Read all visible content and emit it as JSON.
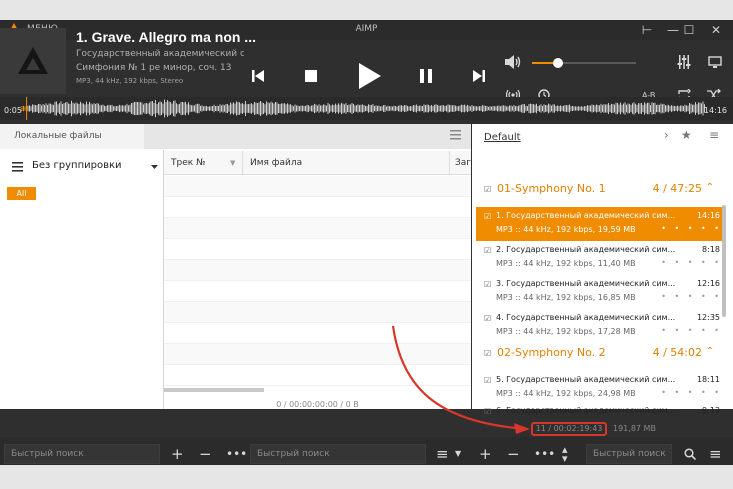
{
  "window": {
    "menu_label": "МЕНЮ",
    "app_title": "AIMP",
    "controls": {
      "pin": "⊢",
      "minimize": "—",
      "maximize": "☐",
      "close": "✕"
    }
  },
  "now_playing": {
    "title": "1. Grave. Allegro ma non ...",
    "artist": "Государственный академический с...",
    "album": "Симфония № 1 ре минор, соч. 13",
    "format_info": "MP3, 44 kHz, 192 kbps, Stereo",
    "volume_fraction": 0.25,
    "ab_label": "A-B"
  },
  "waveform": {
    "elapsed": "0:05",
    "total": "14:16",
    "progress_fraction": 0.006
  },
  "library": {
    "tab_label": "Локальные файлы",
    "grouping_label": "Без группировки",
    "filter_all": "All",
    "columns": [
      "Трек №",
      "Имя файла",
      "Загр"
    ],
    "status": "0 / 00:00:00:00 / 0 B"
  },
  "playlist": {
    "tab_label": "Default",
    "groups": [
      {
        "name": "01-Symphony No. 1",
        "info": "4 / 47:25",
        "tracks": [
          {
            "name": "1. Государственный академический сим...",
            "duration": "14:16",
            "info": "MP3 :: 44 kHz, 192 kbps, 19,59 MB",
            "active": true
          },
          {
            "name": "2. Государственный академический сим...",
            "duration": "8:18",
            "info": "MP3 :: 44 kHz, 192 kbps, 11,40 MB"
          },
          {
            "name": "3. Государственный академический сим...",
            "duration": "12:16",
            "info": "MP3 :: 44 kHz, 192 kbps, 16,85 MB"
          },
          {
            "name": "4. Государственный академический сим...",
            "duration": "12:35",
            "info": "MP3 :: 44 kHz, 192 kbps, 17,28 MB"
          }
        ]
      },
      {
        "name": "02-Symphony No. 2",
        "info": "4 / 54:02",
        "tracks": [
          {
            "name": "5. Государственный академический сим...",
            "duration": "18:11",
            "info": "MP3 :: 44 kHz, 192 kbps, 24,98 MB"
          },
          {
            "name": "6. Государственный академический сим...",
            "duration": "9:13",
            "info": ""
          }
        ]
      }
    ],
    "rating_dots": "• • • • •",
    "status_count": "11 / 00:02:19:43",
    "status_size": "191,87 MB"
  },
  "bottom": {
    "search_placeholder": "Быстрый поиск"
  },
  "colors": {
    "accent": "#f08c00",
    "annotation": "#d9362b"
  }
}
